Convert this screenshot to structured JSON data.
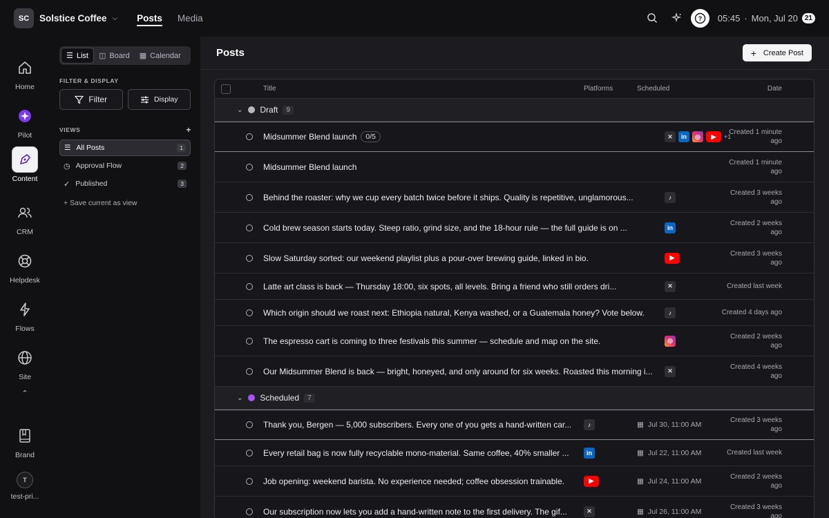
{
  "topbar": {
    "workspace_initials": "SC",
    "workspace_name": "Solstice Coffee",
    "tabs": [
      "Posts",
      "Media"
    ],
    "time": "05:45",
    "date": "Mon, Jul 20",
    "date_badge": "21"
  },
  "rail": {
    "items": [
      "Home",
      "Pilot",
      "Content",
      "CRM",
      "Helpdesk",
      "Flows",
      "Site"
    ],
    "brand": "Brand",
    "user_initial": "T",
    "user_name": "test-pri..."
  },
  "subnav": {
    "view_tabs": [
      "List",
      "Board",
      "Calendar"
    ],
    "filter_section": "FILTER & DISPLAY",
    "filter_label": "Filter",
    "display_label": "Display",
    "views_section": "VIEWS",
    "add": "+",
    "views": [
      {
        "label": "All Posts",
        "count": "1"
      },
      {
        "label": "Approval Flow",
        "count": "2"
      },
      {
        "label": "Published",
        "count": "3"
      }
    ],
    "save_view": "+ Save current as view"
  },
  "main": {
    "title": "Posts",
    "create_label": "Create Post",
    "columns": {
      "title": "Title",
      "platforms": "Platforms",
      "scheduled": "Scheduled",
      "date": "Date"
    }
  },
  "groups": {
    "draft": {
      "label": "Draft",
      "count": "9",
      "color": "#b8b8c0"
    },
    "scheduled": {
      "label": "Scheduled",
      "count": "7",
      "color": "#a855f7"
    }
  },
  "draft_rows": [
    {
      "title": "Midsummer Blend launch",
      "progress": "0/5",
      "platforms": [
        "x",
        "li",
        "ig",
        "yt"
      ],
      "more": "+1",
      "date": "Created 1 minute ago"
    },
    {
      "title": "Midsummer Blend launch",
      "platforms": [],
      "date": "Created 1 minute ago"
    },
    {
      "title": "Behind the roaster: why we cup every batch twice before it ships. Quality is repetitive, unglamorous...",
      "platforms": [
        "tt"
      ],
      "date": "Created 3 weeks ago"
    },
    {
      "title": "Cold brew season starts today. Steep ratio, grind size, and the 18-hour rule — the full guide is on ...",
      "platforms": [
        "li"
      ],
      "date": "Created 2 weeks ago"
    },
    {
      "title": "Slow Saturday sorted: our weekend playlist plus a pour-over brewing guide, linked in bio.",
      "platforms": [
        "yt"
      ],
      "date": "Created 3 weeks ago"
    },
    {
      "title": "Latte art class is back — Thursday 18:00, six spots, all levels. Bring a friend who still orders dri...",
      "platforms": [
        "x"
      ],
      "date": "Created last week"
    },
    {
      "title": "Which origin should we roast next: Ethiopia natural, Kenya washed, or a Guatemala honey? Vote below.",
      "platforms": [
        "tt"
      ],
      "date": "Created 4 days ago"
    },
    {
      "title": "The espresso cart is coming to three festivals this summer — schedule and map on the site.",
      "platforms": [
        "ig"
      ],
      "date": "Created 2 weeks ago"
    },
    {
      "title": "Our Midsummer Blend is back — bright, honeyed, and only around for six weeks. Roasted this morning i...",
      "platforms": [
        "x"
      ],
      "date": "Created 4 weeks ago"
    }
  ],
  "scheduled_rows": [
    {
      "title": "Thank you, Bergen — 5,000 subscribers. Every one of you gets a hand-written car...",
      "platforms": [
        "tt"
      ],
      "scheduled": "Jul 30, 11:00 AM",
      "date": "Created 3 weeks ago"
    },
    {
      "title": "Every retail bag is now fully recyclable mono-material. Same coffee, 40% smaller ...",
      "platforms": [
        "li"
      ],
      "scheduled": "Jul 22, 11:00 AM",
      "date": "Created last week"
    },
    {
      "title": "Job opening: weekend barista. No experience needed; coffee obsession trainable.",
      "platforms": [
        "yt"
      ],
      "scheduled": "Jul 24, 11:00 AM",
      "date": "Created 2 weeks ago"
    },
    {
      "title": "Our subscription now lets you add a hand-written note to the first delivery. The gif...",
      "platforms": [
        "x"
      ],
      "scheduled": "Jul 26, 11:00 AM",
      "date": "Created 3 weeks ago"
    }
  ]
}
